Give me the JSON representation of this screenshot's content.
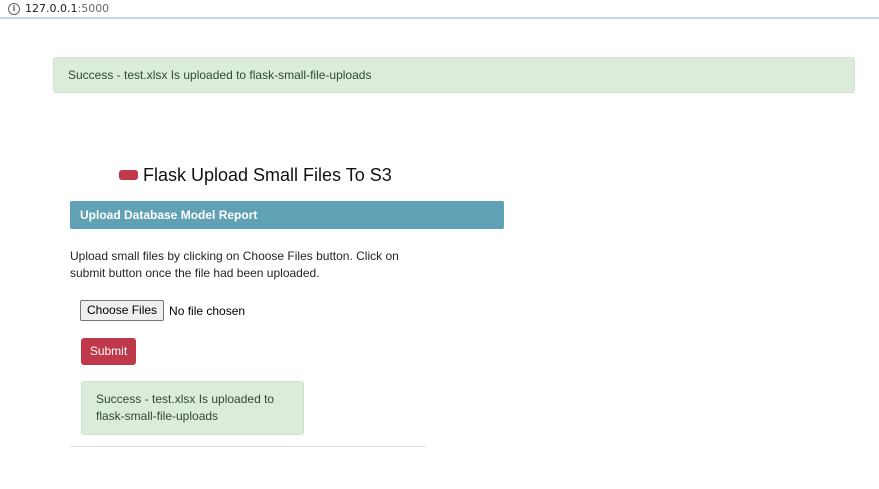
{
  "browser": {
    "url_host": "127.0.0.1",
    "url_port": ":5000",
    "info_icon": "info-icon"
  },
  "alert_top": {
    "text": "Success - test.xlsx Is uploaded to flask-small-file-uploads",
    "color": "#dcecdb"
  },
  "header": {
    "title": "Flask Upload Small Files To S3",
    "badge_color": "#c0394a"
  },
  "card": {
    "header_label": "Upload Database Model Report",
    "header_color": "#61a1b5",
    "instructions": "Upload small files by clicking on Choose Files button. Click on submit button once the file had been uploaded."
  },
  "form": {
    "choose_files_label": "Choose Files",
    "file_status": "No file chosen",
    "submit_label": "Submit",
    "submit_color": "#c0394a"
  },
  "alert_bottom": {
    "text": "Success - test.xlsx Is uploaded to flask-small-file-uploads"
  }
}
